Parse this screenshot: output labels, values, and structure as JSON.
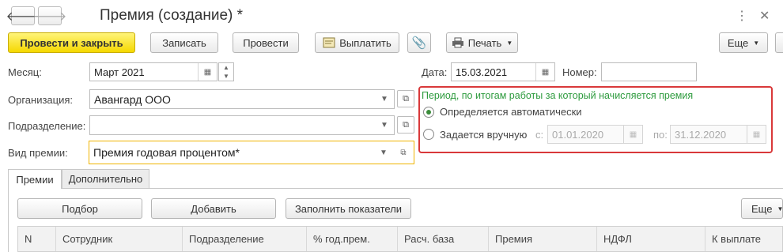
{
  "window": {
    "title": "Премия (создание) *",
    "back_icon": "arrow-left-icon",
    "forward_icon": "arrow-right-icon",
    "more_icon": "more-vertical-icon",
    "close_icon": "close-icon"
  },
  "toolbar": {
    "post_close_label": "Провести и закрыть",
    "save_label": "Записать",
    "post_label": "Провести",
    "pay_label": "Выплатить",
    "print_label": "Печать",
    "more_label": "Еще"
  },
  "fields": {
    "month_label": "Месяц:",
    "month_value": "Март 2021",
    "org_label": "Организация:",
    "org_value": "Авангард ООО",
    "dept_label": "Подразделение:",
    "dept_value": "",
    "bonus_type_label": "Вид премии:",
    "bonus_type_value": "Премия годовая процентом*",
    "date_label": "Дата:",
    "date_value": "15.03.2021",
    "number_label": "Номер:",
    "number_value": ""
  },
  "period": {
    "title": "Период, по итогам работы за который начисляется премия",
    "auto_label": "Определяется автоматически",
    "manual_label": "Задается вручную",
    "from_label": "с:",
    "from_value": "01.01.2020",
    "to_label": "по:",
    "to_value": "31.12.2020",
    "selected": "auto"
  },
  "tabs": [
    {
      "label": "Премии",
      "active": true
    },
    {
      "label": "Дополнительно",
      "active": false
    }
  ],
  "table_toolbar": {
    "pick_label": "Подбор",
    "add_label": "Добавить",
    "fill_label": "Заполнить показатели",
    "more_label": "Еще"
  },
  "table": {
    "columns": [
      "N",
      "Сотрудник",
      "Подразделение",
      "% год.прем.",
      "Расч. база",
      "Премия",
      "НДФЛ",
      "К выплате"
    ]
  },
  "colors": {
    "primary_button": "#f5d800",
    "period_title": "#2e9b3e",
    "highlight_border": "#d9393a",
    "focus_border": "#f0b400"
  }
}
